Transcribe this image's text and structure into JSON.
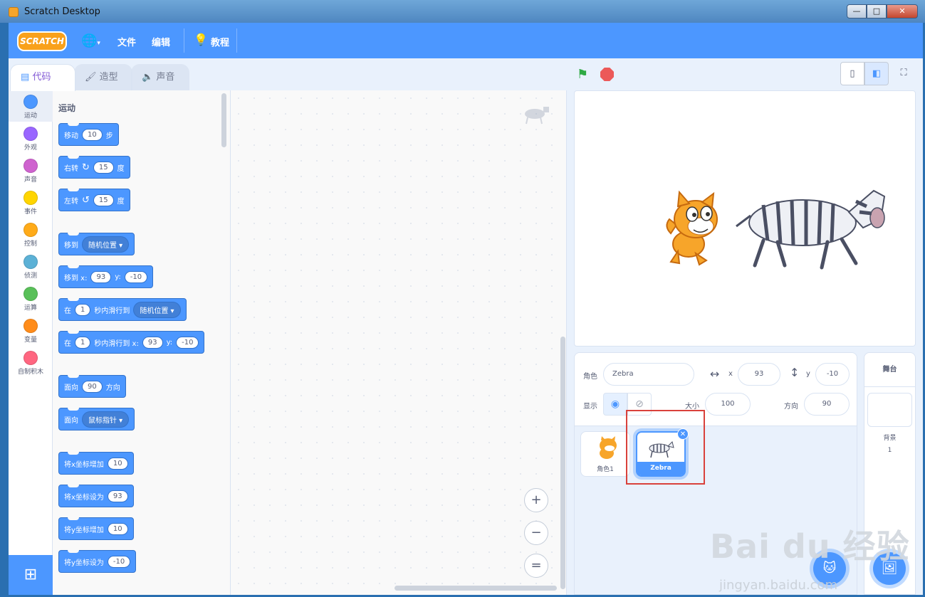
{
  "window": {
    "title": "Scratch Desktop",
    "btn_min": "—",
    "btn_max": "□",
    "btn_close": "✕"
  },
  "menubar": {
    "logo": "SCRATCH",
    "file": "文件",
    "edit": "编辑",
    "tutorials": "教程"
  },
  "tabs": [
    {
      "label": "代码",
      "icon": "code-icon"
    },
    {
      "label": "造型",
      "icon": "brush-icon"
    },
    {
      "label": "声音",
      "icon": "speaker-icon"
    }
  ],
  "categories": [
    {
      "label": "运动",
      "color": "#4c97ff"
    },
    {
      "label": "外观",
      "color": "#9966ff"
    },
    {
      "label": "声音",
      "color": "#cf63cf"
    },
    {
      "label": "事件",
      "color": "#ffd500"
    },
    {
      "label": "控制",
      "color": "#ffab19"
    },
    {
      "label": "侦测",
      "color": "#5cb1d6"
    },
    {
      "label": "运算",
      "color": "#59c059"
    },
    {
      "label": "变量",
      "color": "#ff8c1a"
    },
    {
      "label": "自制积木",
      "color": "#ff6680"
    }
  ],
  "palette": {
    "heading": "运动",
    "b1": {
      "a": "移动",
      "v": "10",
      "b": "步"
    },
    "b2": {
      "a": "右转",
      "v": "15",
      "b": "度"
    },
    "b3": {
      "a": "左转",
      "v": "15",
      "b": "度"
    },
    "b4": {
      "a": "移到",
      "d": "随机位置"
    },
    "b5": {
      "a": "移到 x:",
      "x": "93",
      "yl": "y:",
      "y": "-10"
    },
    "b6": {
      "a": "在",
      "v": "1",
      "b": "秒内滑行到",
      "d": "随机位置"
    },
    "b7": {
      "a": "在",
      "v": "1",
      "b": "秒内滑行到 x:",
      "x": "93",
      "yl": "y:",
      "y": "-10"
    },
    "b8": {
      "a": "面向",
      "v": "90",
      "b": "方向"
    },
    "b9": {
      "a": "面向",
      "d": "鼠标指针"
    },
    "b10": {
      "a": "将x坐标增加",
      "v": "10"
    },
    "b11": {
      "a": "将x坐标设为",
      "v": "93"
    },
    "b12": {
      "a": "将y坐标增加",
      "v": "10"
    },
    "b13": {
      "a": "将y坐标设为",
      "v": "-10"
    }
  },
  "zoom": {
    "in": "+",
    "out": "−",
    "reset": "="
  },
  "sprite_info": {
    "sprite_label": "角色",
    "sprite_name": "Zebra",
    "x_label": "x",
    "x": "93",
    "y_label": "y",
    "y": "-10",
    "show_label": "显示",
    "size_label": "大小",
    "size": "100",
    "direction_label": "方向",
    "direction": "90"
  },
  "sprites": [
    {
      "name": "角色1",
      "selected": false
    },
    {
      "name": "Zebra",
      "selected": true
    }
  ],
  "stage_pane": {
    "title": "舞台",
    "backdrops_label": "背景",
    "backdrops_count": "1"
  },
  "watermark": {
    "brand": "Bai du 经验",
    "url": "jingyan.baidu.com"
  }
}
